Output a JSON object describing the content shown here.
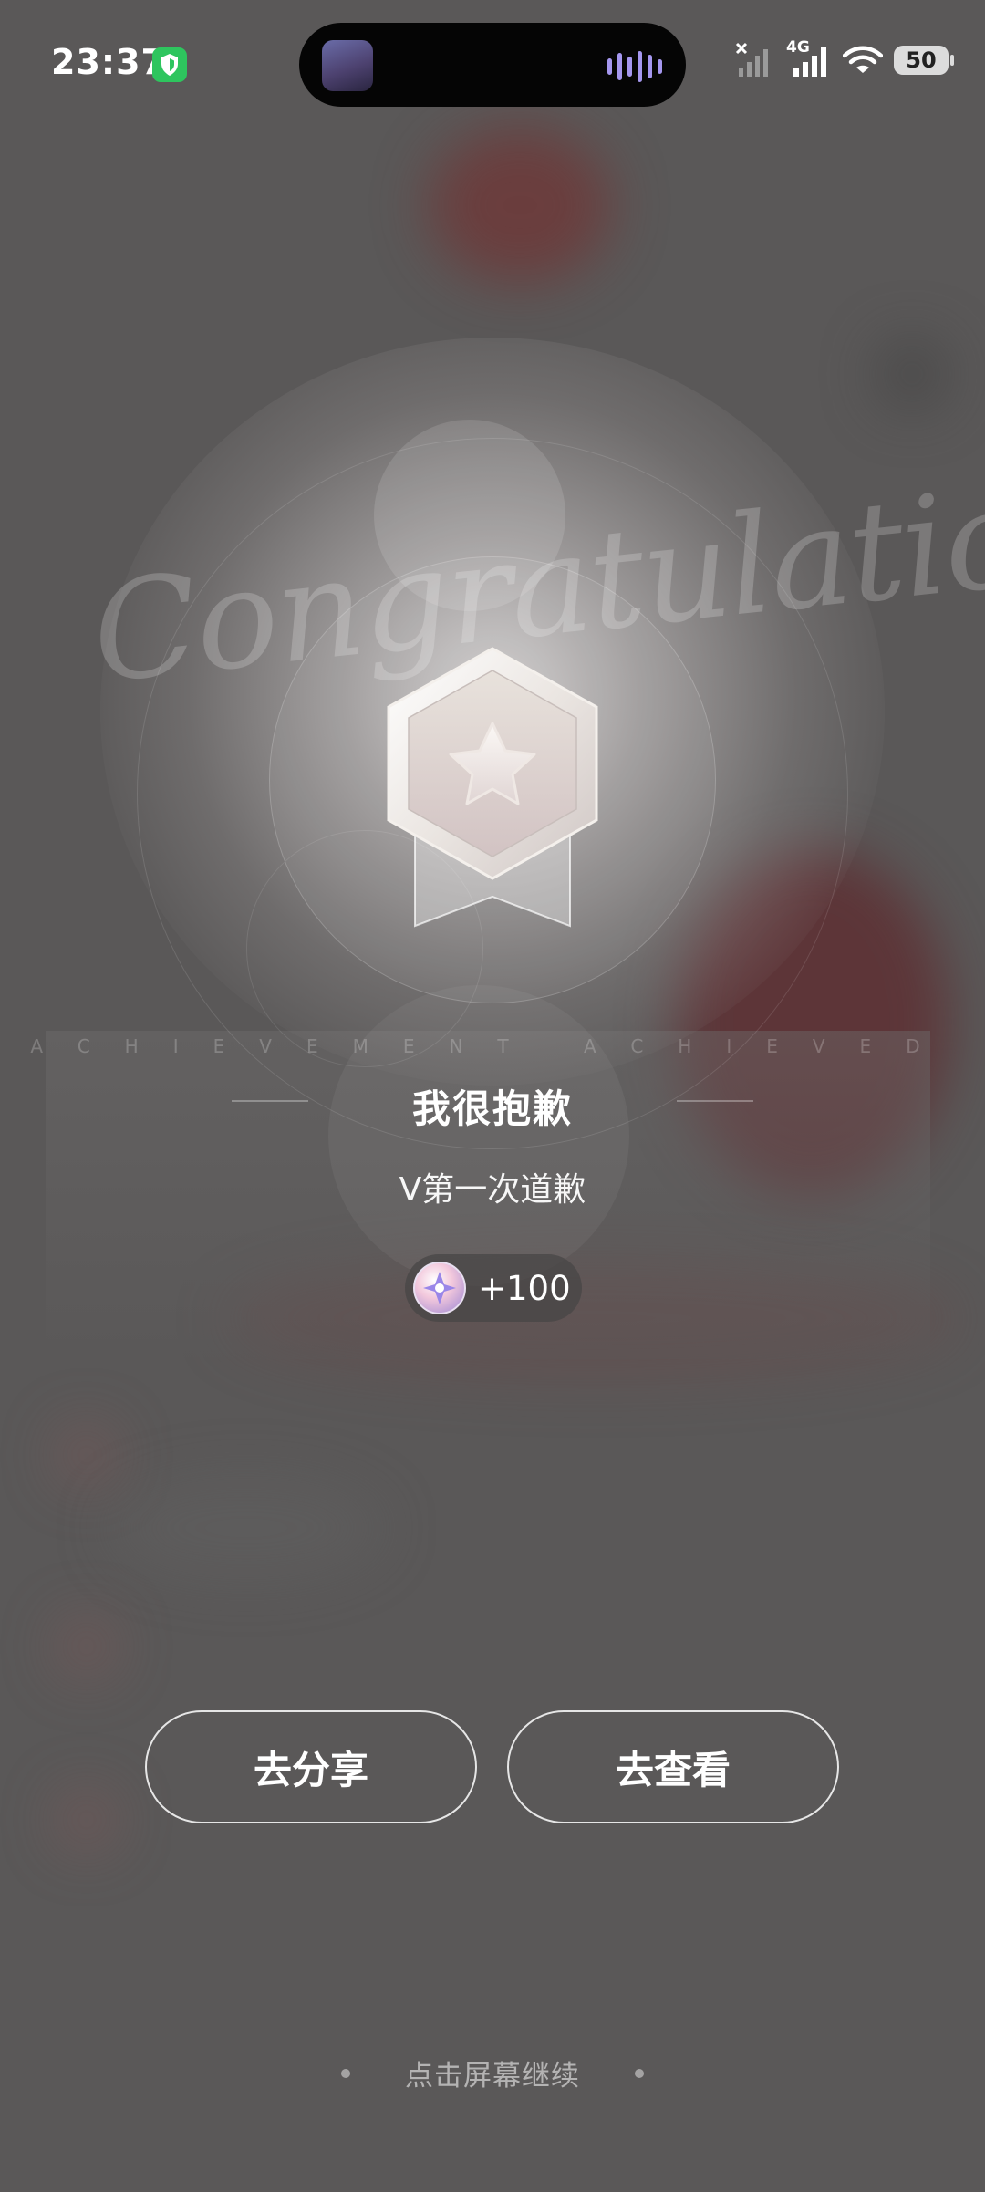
{
  "status_bar": {
    "time": "23:37",
    "network": "4G",
    "battery": "50",
    "icons": [
      "shield-icon",
      "music-thumbnail",
      "audio-wave-icon",
      "no-signal-icon",
      "signal-4g-icon",
      "wifi-icon",
      "battery-icon"
    ]
  },
  "achievement": {
    "decor_script": "Congratulation",
    "caption": "ACHIEVEMENT ACHIEVED",
    "title": "我很抱歉",
    "description": "V第一次道歉",
    "reward": "+100",
    "medal_icon": "star-medal-icon",
    "reward_icon": "gem-coin-icon"
  },
  "actions": {
    "share": "去分享",
    "view": "去查看"
  },
  "footer": {
    "continue": "点击屏幕继续"
  },
  "colors": {
    "overlay": "#5a5858",
    "shield": "#2ec55e",
    "wave": "#a597ef"
  }
}
